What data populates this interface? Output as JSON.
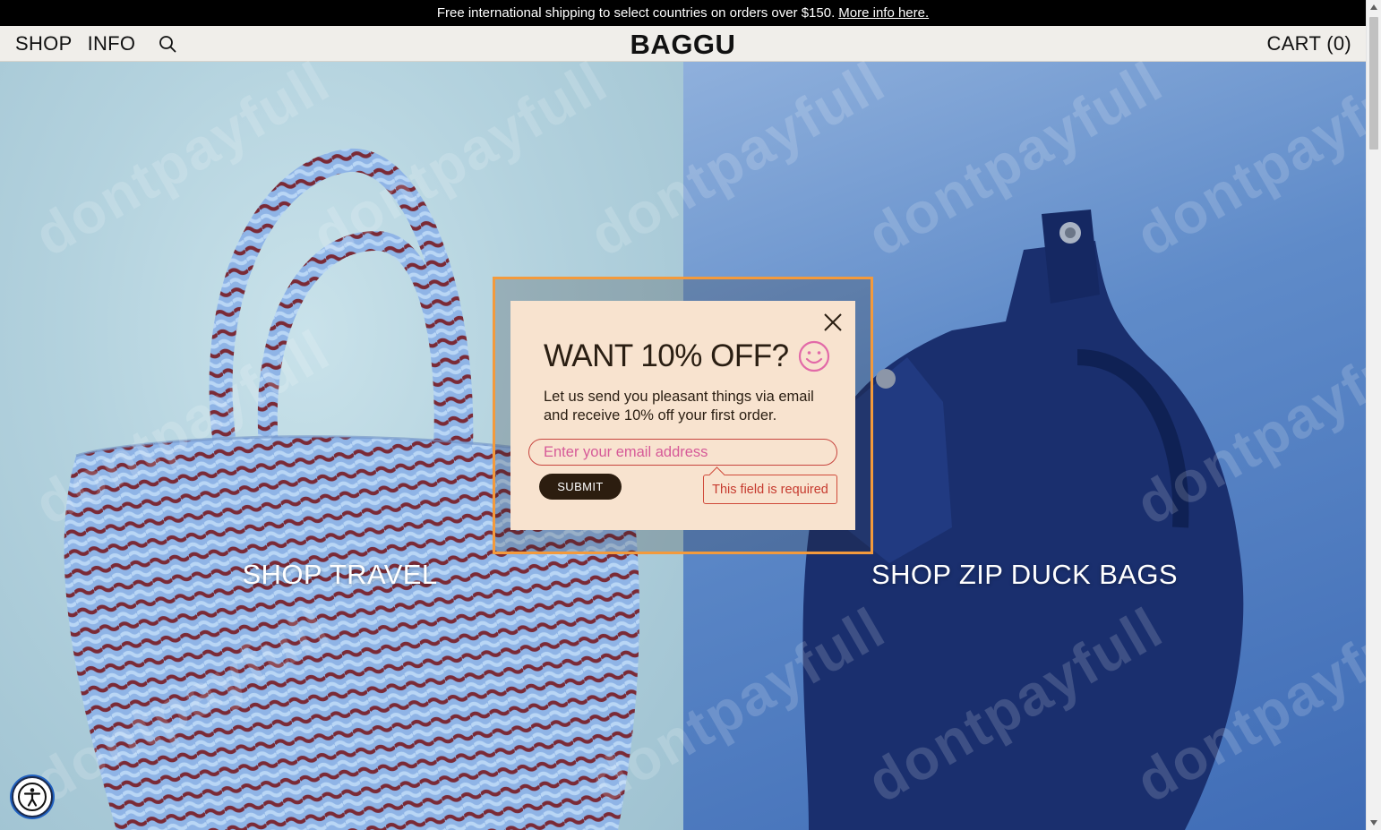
{
  "announcement": {
    "text": "Free international shipping to select countries on orders over $150.",
    "link_label": "More info here."
  },
  "header": {
    "nav": [
      {
        "label": "SHOP"
      },
      {
        "label": "INFO"
      }
    ],
    "search_icon": "search-icon",
    "logo": "BAGGU",
    "cart_label": "CART (0)"
  },
  "hero": {
    "left_label": "SHOP TRAVEL",
    "right_label": "SHOP ZIP DUCK BAGS"
  },
  "watermark_text": "dontpayfull",
  "modal": {
    "title": "WANT 10% OFF?",
    "title_icon": "smiley-icon",
    "body": "Let us send you pleasant things via email and receive 10% off your first order.",
    "email_placeholder": "Enter your email address",
    "email_value": "",
    "submit_label": "SUBMIT",
    "error_text": "This field is required",
    "close_icon": "close-icon"
  },
  "accessibility": {
    "icon": "accessibility-icon"
  },
  "colors": {
    "announcement_bg": "#000000",
    "header_bg": "#f0eeea",
    "modal_bg": "#f8e3cf",
    "highlight_border": "#f39a3c",
    "submit_bg": "#2c1d0f",
    "error": "#c63a2e",
    "placeholder": "#d65a98"
  }
}
